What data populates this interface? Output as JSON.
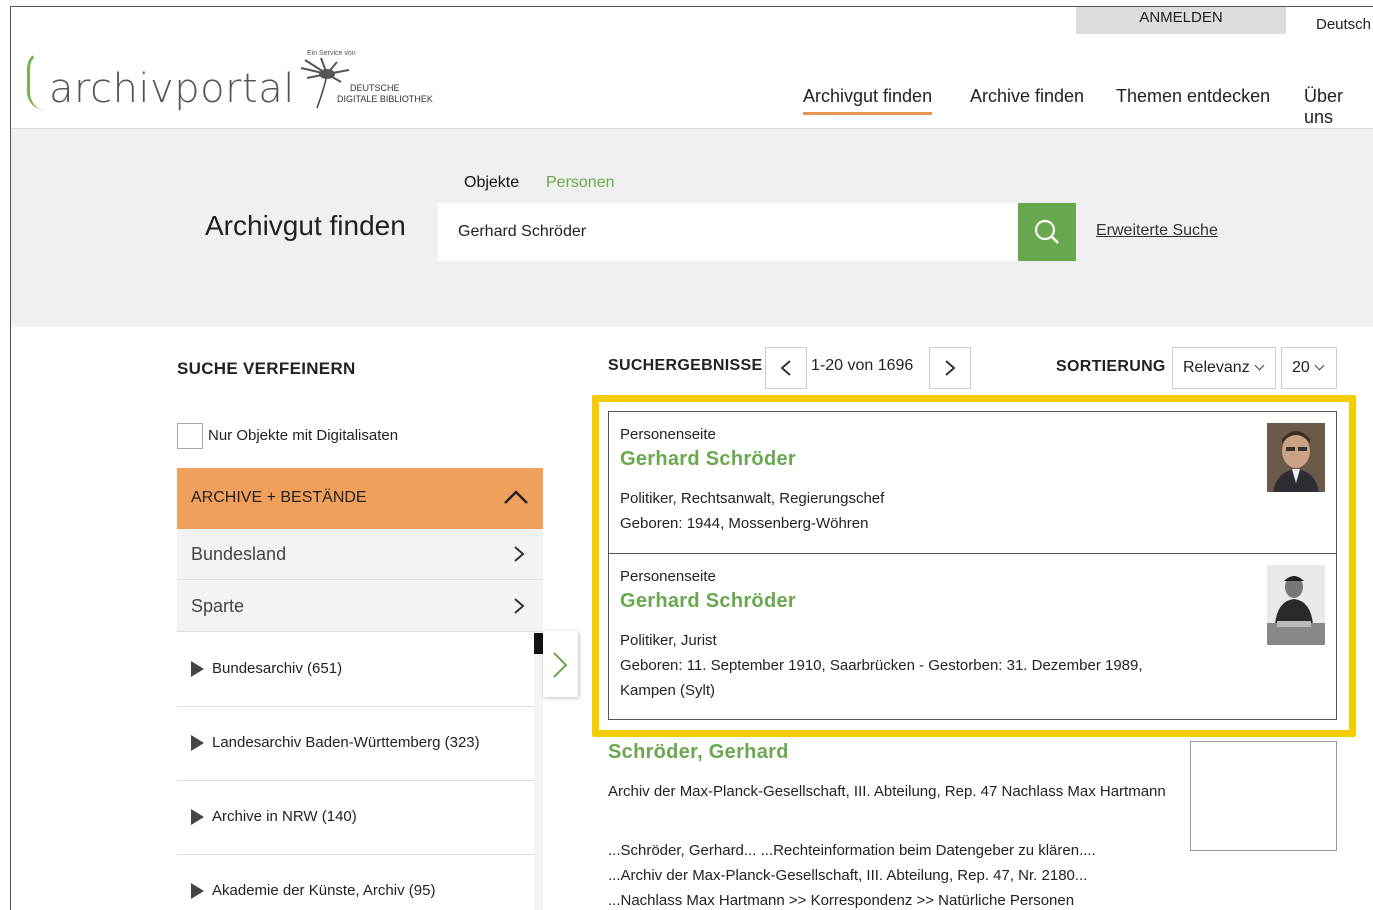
{
  "header": {
    "login_label": "ANMELDEN",
    "language": "Deutsch",
    "logo_text": "archivportal",
    "logo_service": "Ein Service von",
    "logo_ddb_line1": "DEUTSCHE",
    "logo_ddb_line2": "DIGITALE BIBLIOTHEK",
    "nav": [
      "Archivgut finden",
      "Archive finden",
      "Themen entdecken",
      "Über uns"
    ],
    "accent_color": "#e89454"
  },
  "search": {
    "tabs": [
      "Objekte",
      "Personen"
    ],
    "title": "Archivgut finden",
    "query": "Gerhard Schröder",
    "advanced_label": "Erweiterte Suche",
    "button_color": "#6aa84f"
  },
  "sidebar": {
    "heading": "SUCHE VERFEINERN",
    "digital_only_label": "Nur Objekte mit Digitalisaten",
    "accordion_title": "ARCHIVE + BESTÄNDE",
    "filters": [
      "Bundesland",
      "Sparte"
    ],
    "archives": [
      "Bundesarchiv (651)",
      "Landesarchiv Baden-Württemberg (323)",
      "Archive in NRW (140)",
      "Akademie der Künste, Archiv (95)"
    ]
  },
  "results": {
    "heading": "SUCHERGEBNISSE",
    "pagination": "1-20 von 1696",
    "sort_label": "SORTIERUNG",
    "sort_value": "Relevanz",
    "per_page": "20",
    "highlight_color": "#f5cc00",
    "items": [
      {
        "kind": "Personenseite",
        "name": "Gerhard Schröder",
        "line1": "Politiker, Rechtsanwalt, Regierungschef",
        "line2": "Geboren: 1944, Mossenberg-Wöhren"
      },
      {
        "kind": "Personenseite",
        "name": "Gerhard Schröder",
        "line1": "Politiker, Jurist",
        "line2": "Geboren: 11. September 1910, Saarbrücken - Gestorben: 31. Dezember 1989, Kampen (Sylt)"
      }
    ],
    "plain": {
      "name": "Schröder, Gerhard",
      "desc": "Archiv der Max-Planck-Gesellschaft, III. Abteilung, Rep. 47 Nachlass Max Hartmann",
      "snip1": "...Schröder, Gerhard... ...Rechteinformation beim Datengeber zu klären....",
      "snip2": "...Archiv der Max-Planck-Gesellschaft, III. Abteilung, Rep. 47, Nr. 2180...",
      "snip3": "...Nachlass Max Hartmann >> Korrespondenz >> Natürliche Personen"
    }
  }
}
